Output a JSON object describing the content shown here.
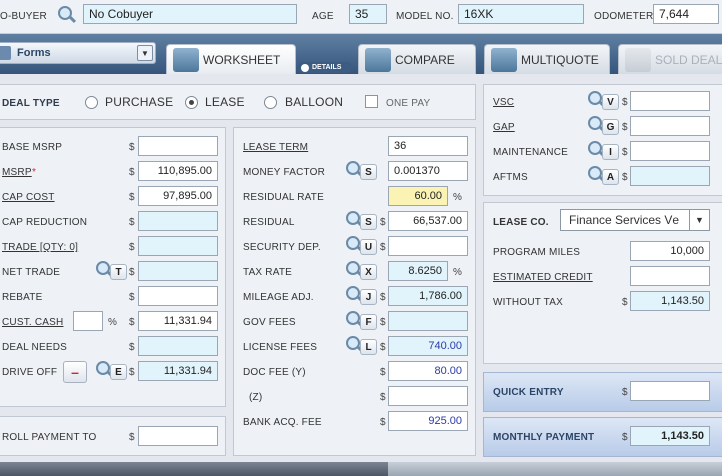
{
  "topbar": {
    "cobuyer_label": "O-BUYER",
    "cobuyer_value": "No Cobuyer",
    "age_label": "AGE",
    "age_value": "35",
    "model_label": "MODEL NO.",
    "model_value": "16XK",
    "odometer_label": "ODOMETER",
    "odometer_value": "7,644"
  },
  "tabs": {
    "forms": "Forms",
    "worksheet": "WORKSHEET",
    "details": "DETAILS",
    "compare": "COMPARE",
    "multiquote": "MULTIQUOTE",
    "sold_deal": "SOLD DEAL"
  },
  "deal_type": {
    "label": "DEAL TYPE",
    "purchase": "PURCHASE",
    "lease": "LEASE",
    "balloon": "BALLOON",
    "one_pay": "ONE PAY"
  },
  "left": {
    "base_msrp": "BASE MSRP",
    "msrp": "MSRP",
    "msrp_star": "*",
    "msrp_value": "110,895.00",
    "cap_cost": "CAP COST",
    "cap_cost_value": "97,895.00",
    "cap_reduction": "CAP REDUCTION",
    "trade": "TRADE [QTY: 0]",
    "net_trade": "NET TRADE",
    "rebate": "REBATE",
    "cust_cash": "CUST. CASH",
    "pct": "%",
    "cust_cash_value": "11,331.94",
    "deal_needs": "DEAL NEEDS",
    "drive_off": "DRIVE OFF",
    "drive_off_value": "11,331.94",
    "minus": "–",
    "roll_payment": "ROLL PAYMENT TO",
    "dollar": "$"
  },
  "middle": {
    "lease_term": "LEASE TERM",
    "lease_term_value": "36",
    "money_factor": "MONEY FACTOR",
    "money_factor_value": "0.001370",
    "residual_rate": "RESIDUAL RATE",
    "residual_rate_value": "60.00",
    "residual": "RESIDUAL",
    "residual_value": "66,537.00",
    "security_dep": "SECURITY DEP.",
    "tax_rate": "TAX RATE",
    "tax_rate_value": "8.6250",
    "mileage_adj": "MILEAGE ADJ.",
    "mileage_adj_value": "1,786.00",
    "gov_fees": "GOV FEES",
    "license_fees": "LICENSE FEES",
    "license_fees_value": "740.00",
    "doc_fee": "DOC FEE (Y)",
    "doc_fee_value": "80.00",
    "z": "(Z)",
    "bank_acq_fee": "BANK ACQ. FEE",
    "bank_acq_fee_value": "925.00"
  },
  "keys": {
    "s": "S",
    "u": "U",
    "x": "X",
    "j": "J",
    "f": "F",
    "l": "L",
    "t": "T",
    "e": "E",
    "v": "V",
    "g": "G",
    "i": "I",
    "a": "A"
  },
  "right": {
    "vsc": "VSC",
    "gap": "GAP",
    "maintenance": "MAINTENANCE",
    "aftms": "AFTMS",
    "lease_co": "LEASE CO.",
    "lease_co_value": "Finance Services Vе",
    "program_miles": "PROGRAM MILES",
    "program_miles_value": "10,000",
    "estimated_credit": "ESTIMATED CREDIT",
    "without_tax": "WITHOUT TAX",
    "without_tax_value": "1,143.50",
    "quick_entry": "QUICK ENTRY",
    "monthly_payment": "MONTHLY PAYMENT",
    "monthly_payment_value": "1,143.50"
  }
}
